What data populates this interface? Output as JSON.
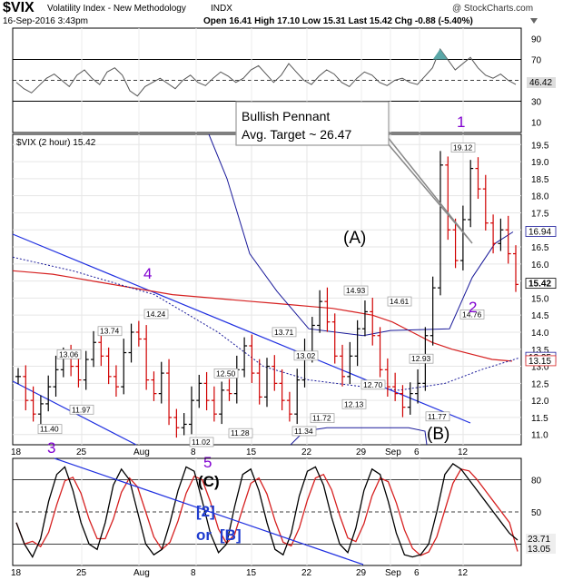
{
  "header": {
    "symbol": "$VIX",
    "name": "Volatility Index - New Methodology",
    "exchange": "INDX",
    "date": "16-Sep-2016 3:43pm",
    "ohlc": "Open 16.41  High 17.10  Low 15.31  Last 15.42  Chg -0.88 (-5.40%)",
    "open": "16.41",
    "high": "17.10",
    "low": "15.31",
    "last": "15.42",
    "chg": "-0.88 (-5.40%)",
    "watermark": "@ StockCharts.com",
    "dropdown_icon": "triangle-down-icon"
  },
  "rsi_panel": {
    "ticks": [
      "90",
      "70",
      "50",
      "30",
      "10"
    ],
    "last_value": "46.42",
    "levels": [
      70,
      50,
      30
    ],
    "color": "#555555"
  },
  "price_panel": {
    "legend": "$VIX (2 hour) 15.42",
    "ticks": [
      "19.5",
      "19.0",
      "18.5",
      "18.0",
      "17.5",
      "17.0",
      "16.5",
      "16.0",
      "15.5",
      "15.0",
      "14.5",
      "14.0",
      "13.5",
      "13.0",
      "12.5",
      "12.0",
      "11.5",
      "11.0"
    ],
    "right_labels": [
      {
        "text": "16.94",
        "value": 16.94,
        "style": "blue"
      },
      {
        "text": "15.42",
        "value": 15.42,
        "style": "black"
      },
      {
        "text": "13.25",
        "value": 13.25,
        "style": "blue"
      },
      {
        "text": "13.15",
        "value": 13.15,
        "style": "red"
      }
    ],
    "swing_labels": [
      {
        "text": "11.40",
        "value": 11.4
      },
      {
        "text": "11.97",
        "value": 11.97
      },
      {
        "text": "13.06",
        "value": 13.06
      },
      {
        "text": "13.74",
        "value": 13.74
      },
      {
        "text": "14.24",
        "value": 14.24
      },
      {
        "text": "11.02",
        "value": 11.02
      },
      {
        "text": "12.50",
        "value": 12.5
      },
      {
        "text": "11.28",
        "value": 11.28
      },
      {
        "text": "13.71",
        "value": 13.71
      },
      {
        "text": "13.02",
        "value": 13.02
      },
      {
        "text": "11.72",
        "value": 11.72
      },
      {
        "text": "11.34",
        "value": 11.34
      },
      {
        "text": "14.93",
        "value": 14.93
      },
      {
        "text": "12.13",
        "value": 12.13
      },
      {
        "text": "12.70",
        "value": 12.7
      },
      {
        "text": "14.61",
        "value": 14.61
      },
      {
        "text": "12.93",
        "value": 12.93
      },
      {
        "text": "11.77",
        "value": 11.77
      },
      {
        "text": "19.12",
        "value": 19.12
      },
      {
        "text": "14.76",
        "value": 14.76
      }
    ],
    "annotation": {
      "line1": "Bullish Pennant",
      "line2": "Avg. Target ~ 26.47"
    },
    "wave_labels": {
      "A": "(A)",
      "B": "(B)",
      "C": "(C)",
      "w1": "1",
      "w2": "2",
      "w3": "3",
      "w4": "4",
      "w5": "5",
      "bracket": "[2]",
      "or": "or",
      "bbracket": "[B]"
    },
    "colors": {
      "up": "#000000",
      "down": "#d00000",
      "ma_red": "#d62020",
      "band_blue": "#1a1a9a",
      "trend": "#2030e0",
      "wave_purple": "#8000d0"
    }
  },
  "stoch_panel": {
    "ticks": [
      "80",
      "50",
      "20"
    ],
    "k_value": "23.71",
    "d_value": "13.05"
  },
  "x_axis": {
    "labels": [
      "18",
      "25",
      "Aug",
      "8",
      "15",
      "22",
      "29",
      "Sep",
      "6",
      "12"
    ]
  },
  "chart_data": {
    "type": "line",
    "title": "$VIX Volatility Index - New Methodology INDX",
    "xlabel": "",
    "ylabel": "",
    "ylim": [
      10.7,
      19.8
    ],
    "series": [
      {
        "values": [
          12.7,
          12.0,
          11.6,
          11.9,
          12.4,
          12.9,
          13.3,
          13.0,
          12.6,
          13.2,
          13.7,
          13.3,
          12.7,
          12.4,
          13.4,
          14.0,
          13.8,
          12.6,
          12.2,
          12.8,
          11.5,
          11.2,
          11.3,
          12.0,
          12.5,
          12.0,
          11.6,
          12.3,
          12.2,
          12.9,
          13.6,
          12.8,
          12.1,
          13.0,
          12.5,
          12.0,
          11.6,
          12.6,
          13.4,
          14.2,
          14.9,
          14.3,
          13.3,
          12.7,
          13.3,
          14.1,
          14.6,
          13.9,
          12.9,
          12.4,
          12.2,
          11.8,
          12.2,
          12.5,
          13.9,
          15.3,
          18.9,
          17.0,
          16.1,
          17.3,
          18.8,
          18.2,
          17.2,
          16.6,
          17.0,
          16.3,
          15.4
        ]
      }
    ]
  }
}
